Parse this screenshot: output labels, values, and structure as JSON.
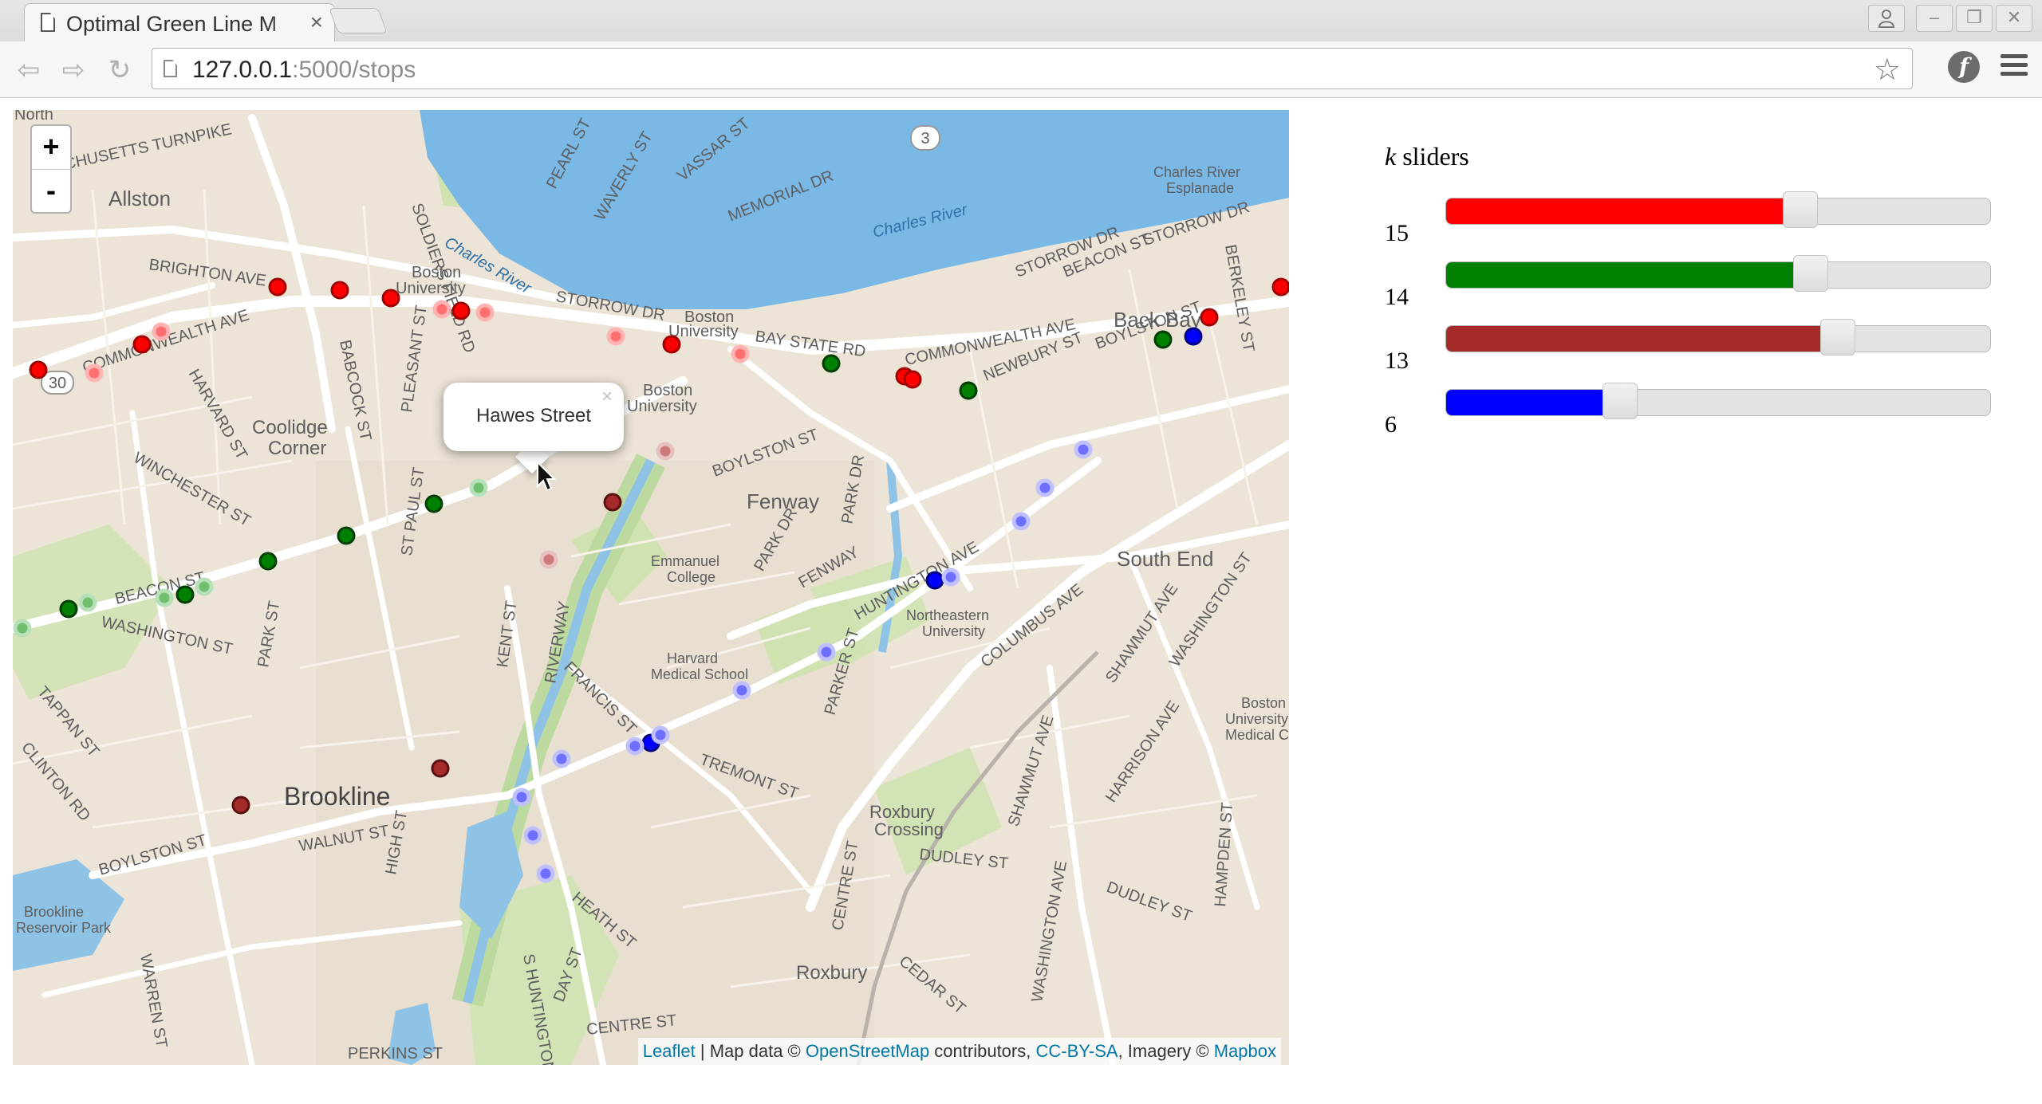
{
  "browser": {
    "tab_title": "Optimal Green Line M",
    "tab_close": "×",
    "url_host": "127.0.0.1",
    "url_rest": ":5000/stops",
    "window_controls": [
      "user-icon",
      "minimize-icon",
      "restore-icon",
      "close-icon"
    ]
  },
  "map": {
    "zoom_in": "+",
    "zoom_out": "-",
    "popup": {
      "text": "Hawes Street",
      "close": "×"
    },
    "attribution": {
      "leaflet": "Leaflet",
      "sep1": " | Map data © ",
      "osm": "OpenStreetMap",
      "sep2": " contributors, ",
      "license": "CC-BY-SA",
      "sep3": ", Imagery © ",
      "mapbox": "Mapbox"
    },
    "labels": {
      "north": "North",
      "mass_tpk": "SACHUSETTS TURNPIKE",
      "allston": "Allston",
      "brighton": "BRIGHTON AVE",
      "bu1": "Boston",
      "bu2": "University",
      "commwealth": "COMMONWEALTH AVE",
      "babcock": "BABCOCK ST",
      "pleasant": "PLEASANT ST",
      "harvard": "HARVARD ST",
      "coolidge1": "Coolidge",
      "coolidge2": "Corner",
      "winchester": "WINCHESTER ST",
      "beacon": "BEACON ST",
      "washington": "WASHINGTON ST",
      "park": "PARK ST",
      "stpaul": "ST PAUL ST",
      "kent": "KENT ST",
      "riverway": "RIVERWAY",
      "francis": "FRANCIS ST",
      "brookline": "Brookline",
      "walnut": "WALNUT ST",
      "boylston": "BOYLSTON ST",
      "high": "HIGH ST",
      "tappan": "TAPPAN ST",
      "clinton": "CLINTON RD",
      "warren": "WARREN ST",
      "brookres1": "Brookline",
      "brookres2": "Reservoir Park",
      "huntington_s": "S HUNTINGTON",
      "heath": "HEATH ST",
      "day": "DAY ST",
      "centre": "CENTRE ST",
      "perkins": "PERKINS ST",
      "soldiers": "SOLDIERS FIELD RD",
      "charles_river": "Charles River",
      "charles_river2": "Charles River",
      "storrow": "STORROW DR",
      "memorial": "MEMORIAL DR",
      "vassar": "VASSAR ST",
      "pearl": "PEARL ST",
      "waverly": "WAVERLY ST",
      "bay_state": "BAY STATE RD",
      "bu3": "Boston",
      "bu4": "University",
      "bu5": "Boston",
      "bu6": "University",
      "commwealth2": "COMMONWEALTH AVE",
      "newbury": "NEWBURY ST",
      "back_bay": "Back Bay",
      "beacon2": "BEACON ST",
      "storrow2": "STORROW DR",
      "storrow3": "STORROW DR",
      "berkeley": "BERKELEY ST",
      "esplanade1": "Charles River",
      "esplanade2": "Esplanade",
      "boylston2": "BOYLSTON ST",
      "boylston3": "BOYLSTON ST",
      "fenway": "Fenway",
      "fenway_rd": "FENWAY",
      "park_dr": "PARK DR",
      "park_dr2": "PARK DR",
      "emmanuel1": "Emmanuel",
      "emmanuel2": "College",
      "hms1": "Harvard",
      "hms2": "Medical School",
      "huntington": "HUNTINGTON AVE",
      "northeastern1": "Northeastern",
      "northeastern2": "University",
      "columbus": "COLUMBUS AVE",
      "south_end": "South End",
      "shawmut": "SHAWMUT AVE",
      "washington2": "WASHINGTON ST",
      "bmc1": "Boston",
      "bmc2": "University",
      "bmc3": "Medical Car",
      "tremont": "TREMONT ST",
      "parker": "PARKER ST",
      "roxbury_crossing1": "Roxbury",
      "roxbury_crossing2": "Crossing",
      "dudley": "DUDLEY ST",
      "dudley2": "DUDLEY ST",
      "harrison": "HARRISON AVE",
      "shawmut2": "SHAWMUT AVE",
      "hampden": "HAMPDEN ST",
      "roxbury": "Roxbury",
      "cedar": "CEDAR ST",
      "centre2": "CENTRE ST",
      "route3": "3",
      "route30": "30",
      "washington_bot": "WASHINGTON AVE"
    }
  },
  "panel": {
    "title_k": "k",
    "title_rest": " sliders",
    "sliders": [
      {
        "name": "red",
        "value": "15",
        "level": 0.65,
        "color": "#ff0000"
      },
      {
        "name": "green",
        "value": "14",
        "level": 0.67,
        "color": "#008000"
      },
      {
        "name": "brown",
        "value": "13",
        "level": 0.72,
        "color": "#a52a2a"
      },
      {
        "name": "blue",
        "value": "6",
        "level": 0.32,
        "color": "#0000ff"
      }
    ]
  }
}
